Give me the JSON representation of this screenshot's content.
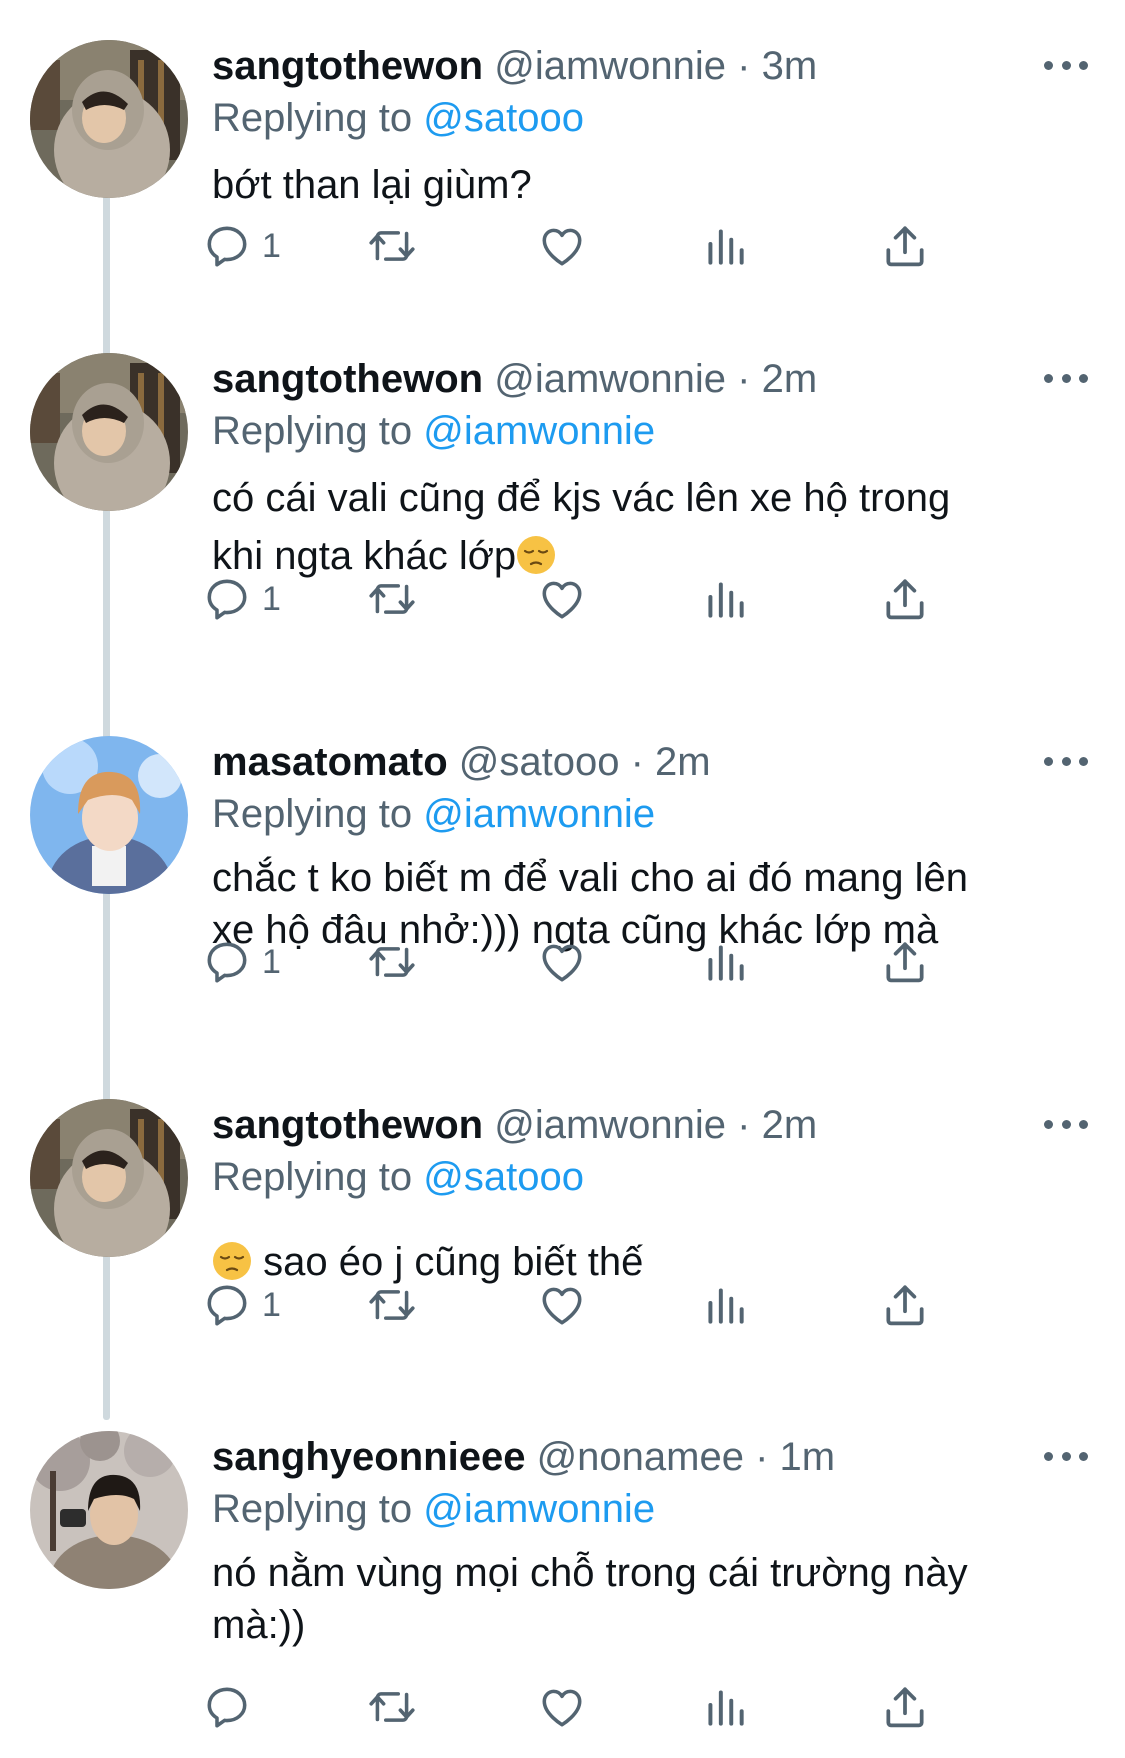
{
  "tweets": [
    {
      "name": "sangtothewon",
      "handle": "@iamwonnie",
      "dot": "·",
      "time": "3m",
      "replying_label": "Replying to",
      "replying_to": "@satooo",
      "text_lines": [
        "bớt than lại giùm?"
      ],
      "reply_count": "1",
      "avatar": "hooded-boy-avatar"
    },
    {
      "name": "sangtothewon",
      "handle": "@iamwonnie",
      "dot": "·",
      "time": "2m",
      "replying_label": "Replying to",
      "replying_to": "@iamwonnie",
      "text_lines": [
        "có cái vali cũng để kjs vác lên xe hộ trong",
        "khi ngta khác lớp"
      ],
      "reply_count": "1",
      "avatar": "hooded-boy-avatar"
    },
    {
      "name": "masatomato",
      "handle": "@satooo",
      "dot": "·",
      "time": "2m",
      "replying_label": "Replying to",
      "replying_to": "@iamwonnie",
      "text_lines": [
        "chắc t ko biết m để vali cho ai đó mang lên",
        "xe hộ đâu nhở:))) ngta cũng khác lớp mà"
      ],
      "reply_count": "1",
      "avatar": "blue-stage-avatar"
    },
    {
      "name": "sangtothewon",
      "handle": "@iamwonnie",
      "dot": "·",
      "time": "2m",
      "replying_label": "Replying to",
      "replying_to": "@satooo",
      "text_lines": [
        "sao éo j cũng biết thế"
      ],
      "reply_count": "1",
      "avatar": "hooded-boy-avatar"
    },
    {
      "name": "sanghyeonnieee",
      "handle": "@nonamee",
      "dot": "·",
      "time": "1m",
      "replying_label": "Replying to",
      "replying_to": "@iamwonnie",
      "text_lines": [
        "nó nằm vùng mọi chỗ trong cái trường này",
        "mà:))"
      ],
      "reply_count": "",
      "avatar": "outdoor-boy-avatar"
    }
  ],
  "icons": {
    "reply": "reply-icon",
    "retweet": "retweet-icon",
    "like": "heart-icon",
    "views": "views-icon",
    "share": "share-icon",
    "more": "more-icon",
    "emoji": "pensive-face-emoji"
  },
  "colors": {
    "mention": "#1d9bf0",
    "secondary_text": "#536471",
    "thread_line": "#cfd9de"
  }
}
